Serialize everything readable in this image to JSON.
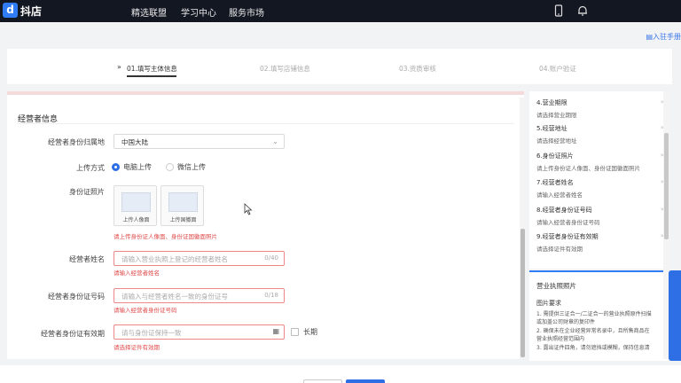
{
  "brand": {
    "logo_glyph": "d",
    "name": "抖店"
  },
  "nav": {
    "items": [
      "精选联盟",
      "学习中心",
      "服务市场"
    ]
  },
  "help_link": "入驻手册",
  "steps": {
    "items": [
      "01.填写主体信息",
      "02.填写店铺信息",
      "03.资质审核",
      "04.账户验证"
    ],
    "active_marker": "»"
  },
  "form": {
    "section_title": "经营者信息",
    "region": {
      "label": "经营者身份归属地",
      "value": "中国大陆"
    },
    "upload_method": {
      "label": "上传方式",
      "options": [
        "电脑上传",
        "微信上传"
      ],
      "selected": "电脑上传"
    },
    "id_photo": {
      "label": "身份证照片",
      "front_label": "上传人像面",
      "back_label": "上传国徽面",
      "error": "请上传身份证人像面、身份证国徽面照片"
    },
    "name": {
      "label": "经营者姓名",
      "placeholder": "请输入营业执照上登记的经营者姓名",
      "count": "0/40",
      "error": "请输入经营者姓名"
    },
    "id_number": {
      "label": "经营者身份证号码",
      "placeholder": "请输入与经营者姓名一致的身份证号",
      "count": "0/18",
      "error": "请输入经营者身份证号码"
    },
    "validity": {
      "label": "经营者身份证有效期",
      "placeholder": "请与身份证保持一致",
      "long_term_label": "长期",
      "error": "请选择证件有效期"
    }
  },
  "side": {
    "items": [
      {
        "title": "4.营业期限",
        "sub": "请选择营业期限"
      },
      {
        "title": "5.经营地址",
        "sub": "请选择经营地址"
      },
      {
        "title": "6.身份证照片",
        "sub": "请上传身份证人像面、身份证国徽面照片"
      },
      {
        "title": "7.经营者姓名",
        "sub": "请输入经营者姓名"
      },
      {
        "title": "8.经营者身份证号码",
        "sub": "请输入经营者身份证号码"
      },
      {
        "title": "9.经营者身份证有效期",
        "sub": "请选择证件有效期"
      }
    ],
    "arrow": "»",
    "license": {
      "heading": "营业执照照片",
      "req_title": "图片要求",
      "lines": [
        "1. 需提供三证合一/二证合一的营业执照原件扫描",
        "   或加盖公司财章的复印件",
        "2. 确保未在企业经营异常名录中，且所售商品在",
        "   营业执照经营范围内",
        "3. 露出证件四角，请勿遮挡或模糊，保持信息清"
      ]
    }
  },
  "colors": {
    "accent": "#2f6fe6",
    "error": "#e04a4a",
    "nav_bg": "#131722"
  }
}
